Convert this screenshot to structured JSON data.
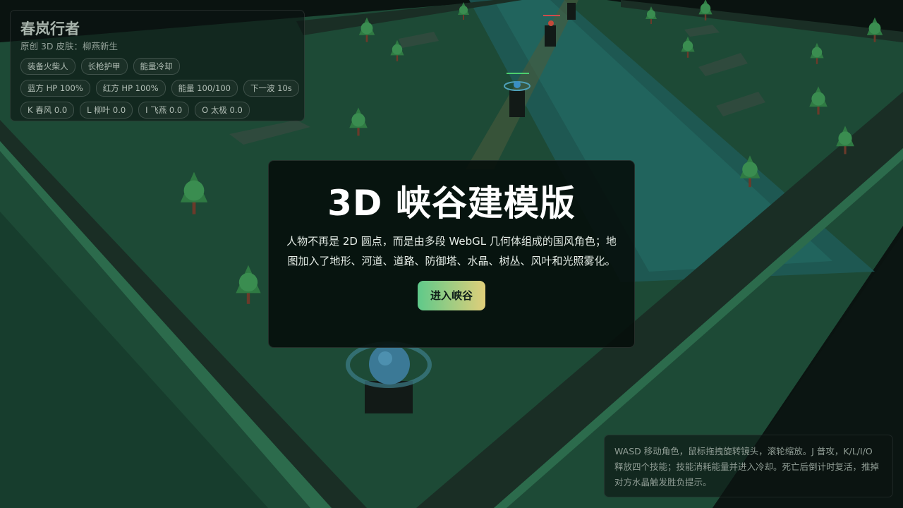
{
  "hud": {
    "title": "春岚行者",
    "subtitle": "原创 3D 皮肤：柳燕新生",
    "tags": [
      "装备火柴人",
      "长枪护甲",
      "能量冷却"
    ],
    "stats": [
      "蓝方 HP 100%",
      "红方 HP 100%",
      "能量 100/100",
      "下一波 10s"
    ],
    "skills": [
      "K 春风 0.0",
      "L 柳叶 0.0",
      "I 飞燕 0.0",
      "O 太极 0.0"
    ]
  },
  "modal": {
    "title": "3D 峡谷建模版",
    "description": "人物不再是 2D 圆点，而是由多段 WebGL 几何体组成的国风角色；地图加入了地形、河道、道路、防御塔、水晶、树丛、风叶和光照雾化。",
    "enter_label": "进入峡谷"
  },
  "help": {
    "text": "WASD 移动角色，鼠标拖拽旋转镜头，滚轮缩放。J 普攻，K/L/I/O 释放四个技能；技能消耗能量并进入冷却。死亡后倒计时复活，推掉对方水晶触发胜负提示。"
  },
  "colors": {
    "ground": "#1d4a36",
    "river": "#1e5b57",
    "road": "#1a2e25",
    "accent_start": "#5fc98a",
    "accent_end": "#e0cf7a"
  }
}
